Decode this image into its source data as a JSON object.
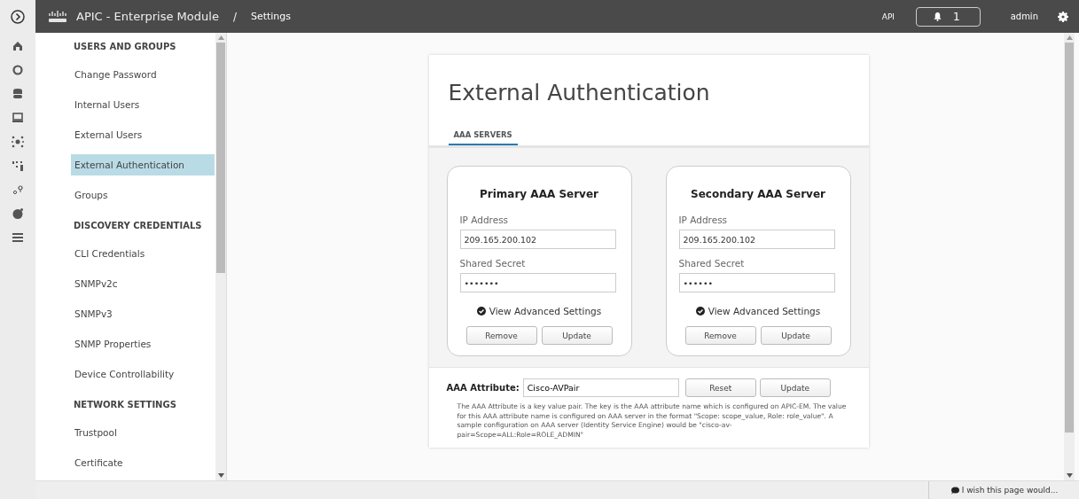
{
  "header": {
    "product": "APIC - Enterprise Module",
    "separator": "/",
    "page": "Settings",
    "api": "API",
    "notifications": "1",
    "user": "admin"
  },
  "sidebar": {
    "sections": [
      {
        "title": "USERS AND GROUPS",
        "items": [
          {
            "label": "Change Password",
            "selected": false
          },
          {
            "label": "Internal Users",
            "selected": false
          },
          {
            "label": "External Users",
            "selected": false
          },
          {
            "label": "External Authentication",
            "selected": true
          },
          {
            "label": "Groups",
            "selected": false
          }
        ]
      },
      {
        "title": "DISCOVERY CREDENTIALS",
        "items": [
          {
            "label": "CLI Credentials",
            "selected": false
          },
          {
            "label": "SNMPv2c",
            "selected": false
          },
          {
            "label": "SNMPv3",
            "selected": false
          },
          {
            "label": "SNMP Properties",
            "selected": false
          },
          {
            "label": "Device Controllability",
            "selected": false
          }
        ]
      },
      {
        "title": "NETWORK SETTINGS",
        "items": [
          {
            "label": "Trustpool",
            "selected": false
          },
          {
            "label": "Certificate",
            "selected": false
          }
        ]
      }
    ]
  },
  "panel": {
    "title": "External Authentication",
    "tabs": [
      {
        "label": "AAA SERVERS",
        "selected": true
      }
    ],
    "servers": [
      {
        "title": "Primary AAA Server",
        "ip_label": "IP Address",
        "ip_value": "209.165.200.102",
        "secret_label": "Shared Secret",
        "secret_value": "•••••••",
        "advanced": "View Advanced Settings",
        "buttons": [
          "Remove",
          "Update"
        ]
      },
      {
        "title": "Secondary AAA Server",
        "ip_label": "IP Address",
        "ip_value": "209.165.200.102",
        "secret_label": "Shared Secret",
        "secret_value": "••••••",
        "advanced": "View Advanced Settings",
        "buttons": [
          "Remove",
          "Update"
        ]
      }
    ],
    "attribute": {
      "label": "AAA Attribute:",
      "value": "Cisco-AVPair",
      "buttons": [
        "Reset",
        "Update"
      ],
      "description": "The AAA Attribute is a key value pair. The key is the AAA attribute name which is configured on APIC-EM. The value for this AAA attribute name is configured on AAA server in the format \"Scope: scope_value, Role: role_value\". A sample configuration on AAA server (Identity Service Engine) would be \"cisco-av-pair=Scope=ALL:Role=ROLE_ADMIN\""
    }
  },
  "feedback": "I wish this page would..."
}
